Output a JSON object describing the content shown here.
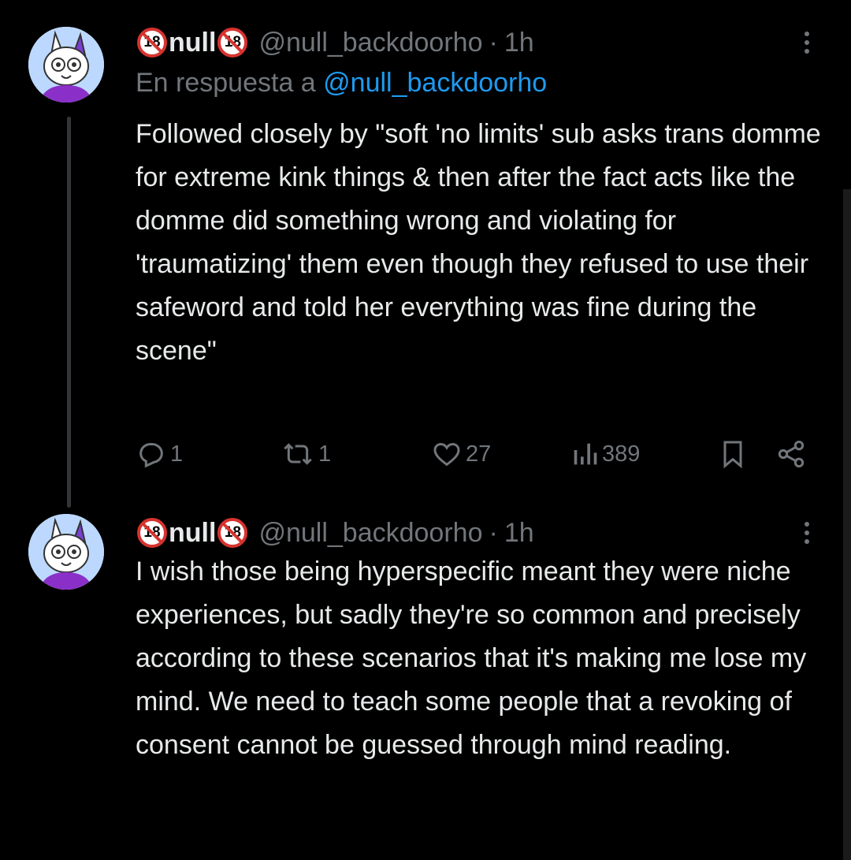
{
  "tweets": [
    {
      "display_name": "null",
      "badge_text": "18",
      "handle": "@null_backdoorho",
      "separator": "·",
      "time": "1h",
      "reply_prefix": "En respuesta a",
      "reply_mention": "@null_backdoorho",
      "text": "Followed closely by \"soft 'no limits' sub asks trans domme for extreme kink things & then after the fact acts like the domme did something wrong and violating for 'traumatizing' them even though they refused to use their safeword and told her everything was fine during the scene\"",
      "actions": {
        "replies": "1",
        "reposts": "1",
        "likes": "27",
        "views": "389"
      }
    },
    {
      "display_name": "null",
      "badge_text": "18",
      "handle": "@null_backdoorho",
      "separator": "·",
      "time": "1h",
      "text": "I wish those being hyperspecific meant they were niche experiences, but sadly they're so common and precisely according to these scenarios that it's making me lose my mind. We need to teach some people that a revoking of consent cannot be guessed through mind reading."
    }
  ],
  "icons": [
    "more-icon",
    "reply-icon",
    "repost-icon",
    "like-icon",
    "views-icon",
    "bookmark-icon",
    "share-icon",
    "no-under-18-icon"
  ],
  "colors": {
    "background": "#000000",
    "text": "#e7e9ea",
    "muted": "#71767b",
    "link": "#1d9bf0",
    "badge_red": "#d6332f"
  }
}
